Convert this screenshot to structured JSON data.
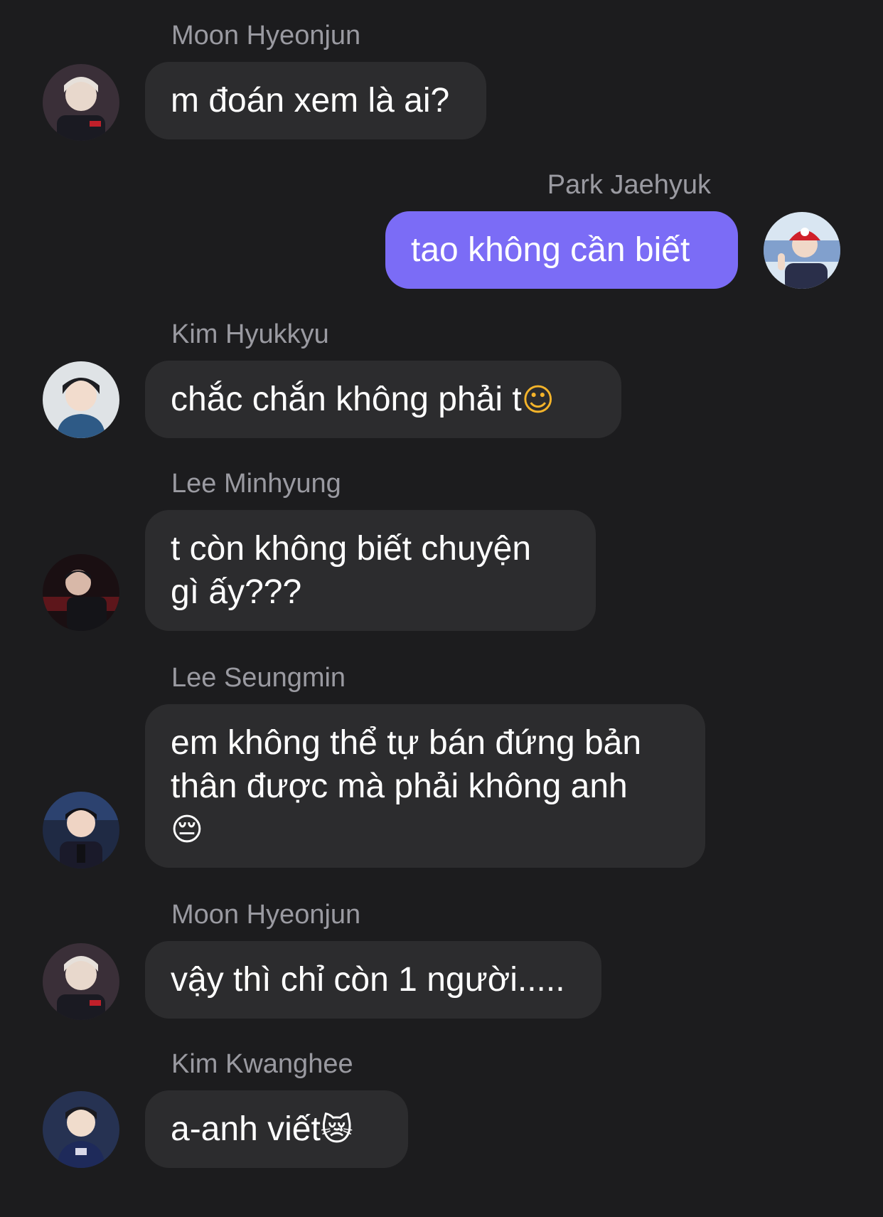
{
  "messages": [
    {
      "sender": "Moon Hyeonjun",
      "text": "m đoán xem là ai?",
      "direction": "incoming",
      "avatar": "avatar-moon-hyeonjun"
    },
    {
      "sender": "Park Jaehyuk",
      "text": "tao không cần biết",
      "direction": "outgoing",
      "avatar": "avatar-park-jaehyuk"
    },
    {
      "sender": "Kim Hyukkyu",
      "text": "chắc chắn không phải t",
      "emoji": "☺",
      "direction": "incoming",
      "avatar": "avatar-kim-hyukkyu"
    },
    {
      "sender": "Lee Minhyung",
      "text_lines": [
        "t còn không biết chuyện",
        "gì ấy???"
      ],
      "direction": "incoming",
      "avatar": "avatar-lee-minhyung"
    },
    {
      "sender": "Lee Seungmin",
      "text_lines": [
        "em không thể tự bán đứng bản",
        "thân được mà phải không anh"
      ],
      "emoji": "😔",
      "direction": "incoming",
      "avatar": "avatar-lee-seungmin"
    },
    {
      "sender": "Moon Hyeonjun",
      "text": "vậy thì chỉ còn 1 người.....",
      "direction": "incoming",
      "avatar": "avatar-moon-hyeonjun"
    },
    {
      "sender": "Kim Kwanghee",
      "text": "a-anh viết",
      "emoji": "😿",
      "direction": "incoming",
      "avatar": "avatar-kim-kwanghee"
    }
  ],
  "colors": {
    "background": "#1c1c1e",
    "incoming_bubble": "#2c2c2e",
    "outgoing_bubble": "#7b6cf6",
    "sender_name": "#9a9aa1",
    "message_text": "#ffffff"
  }
}
